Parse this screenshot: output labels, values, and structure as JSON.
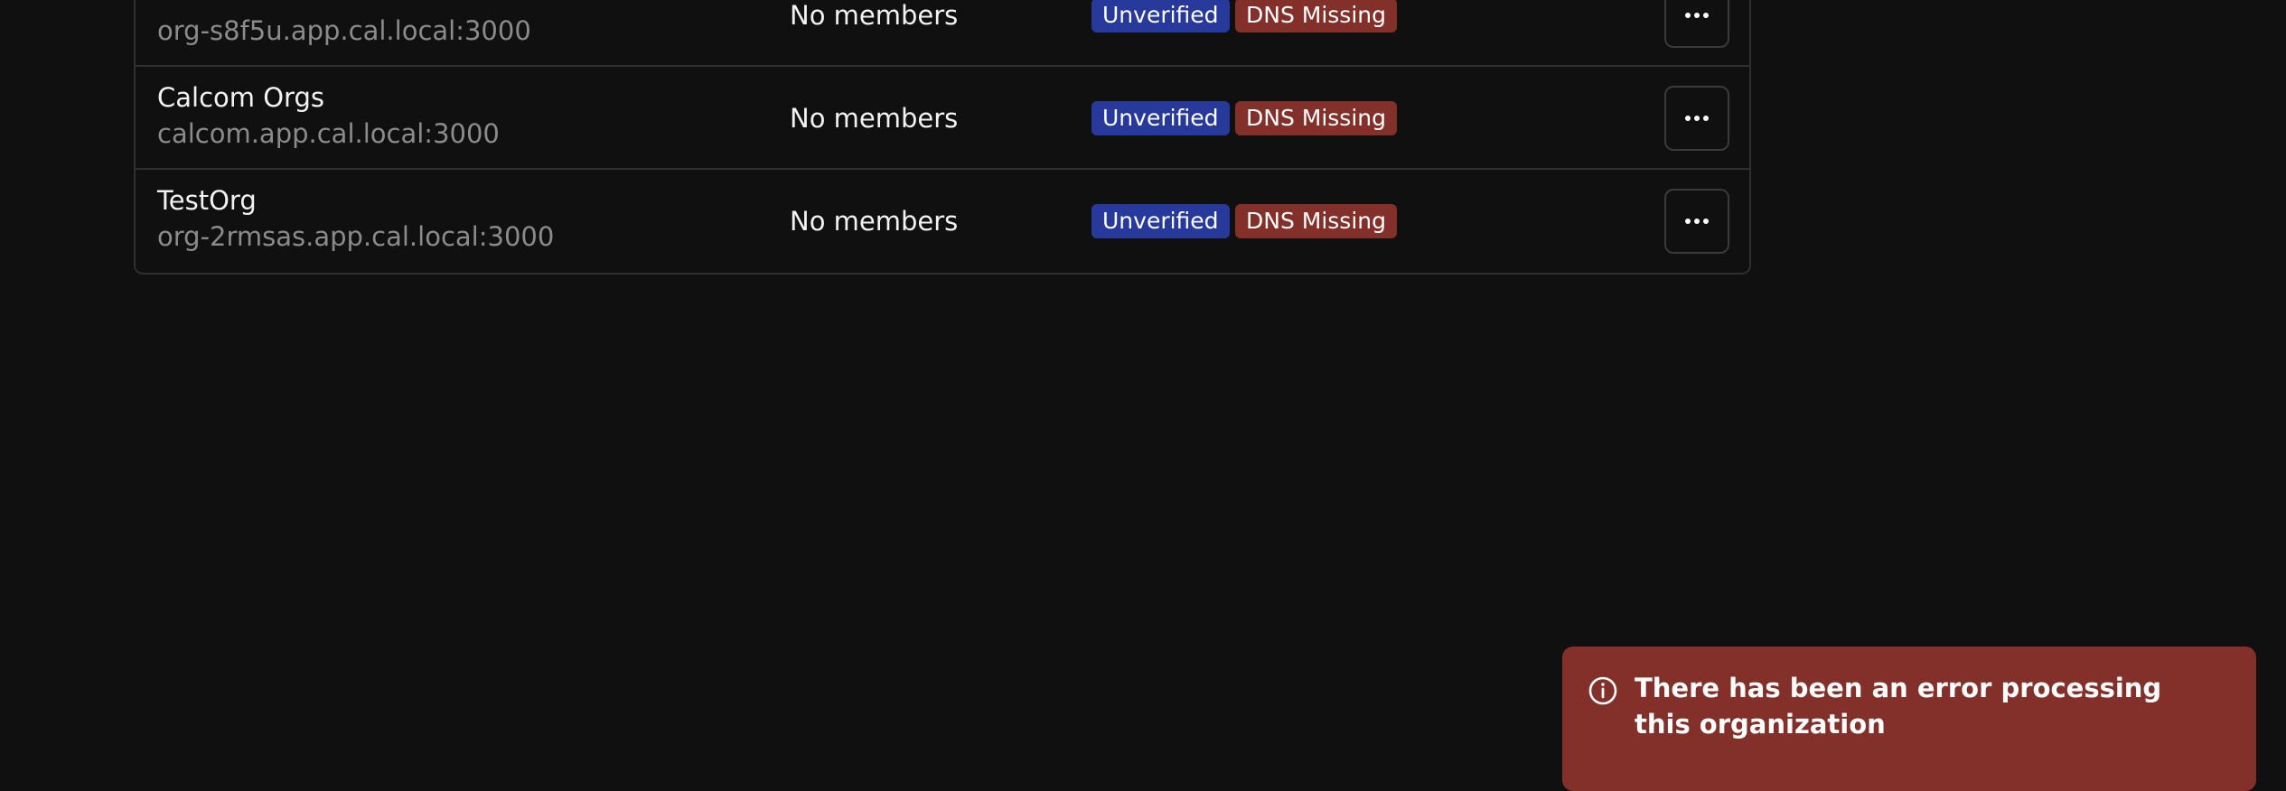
{
  "colors": {
    "unverified": "#273a9c",
    "dns_missing": "#84302a",
    "toast": "#84302a"
  },
  "organizations": [
    {
      "name": "",
      "domain": "org-s8f5u.app.cal.local:3000",
      "members": "No members",
      "badges": [
        "Unverified",
        "DNS Missing"
      ],
      "action_icon": "more-icon"
    },
    {
      "name": "Calcom Orgs",
      "domain": "calcom.app.cal.local:3000",
      "members": "No members",
      "badges": [
        "Unverified",
        "DNS Missing"
      ],
      "action_icon": "more-icon"
    },
    {
      "name": "TestOrg",
      "domain": "org-2rmsas.app.cal.local:3000",
      "members": "No members",
      "badges": [
        "Unverified",
        "DNS Missing"
      ],
      "action_icon": "more-icon"
    }
  ],
  "toast": {
    "message": "There has been an error processing this organization",
    "icon": "info-icon"
  }
}
